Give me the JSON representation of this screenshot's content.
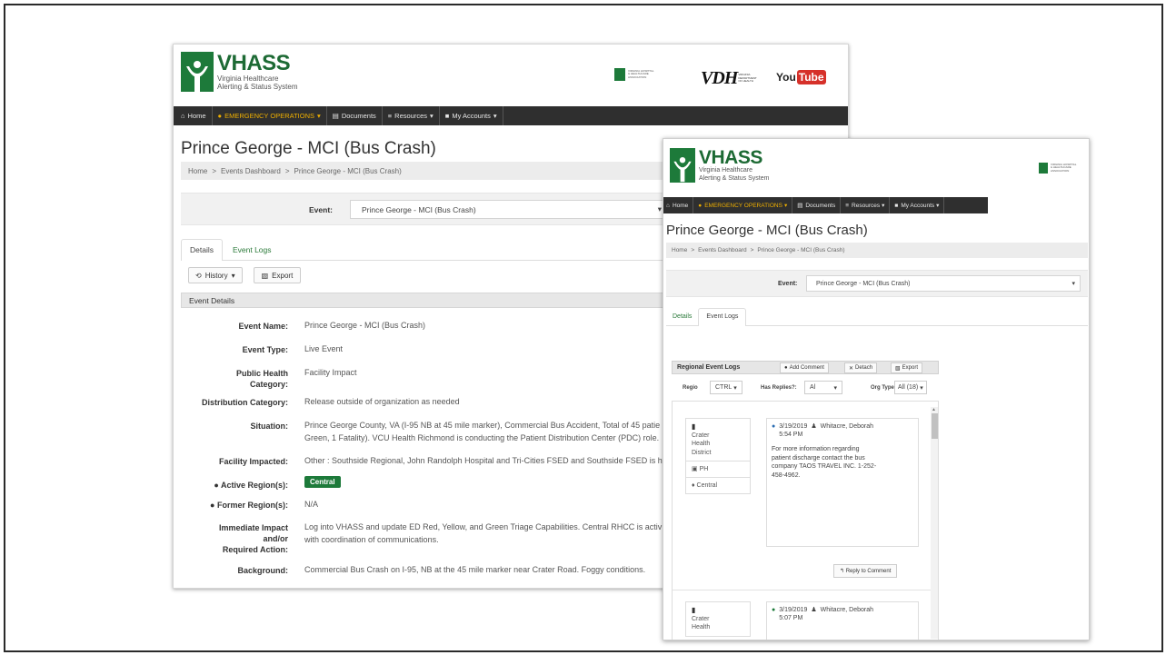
{
  "brand": {
    "name": "VHASS",
    "subtitle_line1": "Virginia Healthcare",
    "subtitle_line2": "Alerting & Status System",
    "color": "#1d7a3a"
  },
  "partners": {
    "vhha_line1": "VIRGINIA HOSPITAL",
    "vhha_line2": "& HEALTHCARE",
    "vhha_line3": "ASSOCIATION",
    "vdh_mark": "VDH",
    "vdh_line1": "VIRGINIA",
    "vdh_line2": "DEPARTMENT",
    "vdh_line3": "OF HEALTH",
    "youtube_left": "You",
    "youtube_right": "Tube"
  },
  "nav": {
    "home": "Home",
    "emergency": "EMERGENCY OPERATIONS",
    "documents": "Documents",
    "resources": "Resources",
    "accounts": "My Accounts",
    "emergency_color": "#f0b000"
  },
  "page": {
    "title": "Prince George - MCI (Bus Crash)",
    "crumb_home": "Home",
    "crumb_dashboard": "Events Dashboard",
    "crumb_current": "Prince George - MCI (Bus Crash)",
    "sep": ">",
    "event_label": "Event:",
    "event_value": "Prince George - MCI (Bus Crash)"
  },
  "tabs": {
    "details": "Details",
    "event_logs": "Event Logs"
  },
  "toolbar": {
    "history": "History",
    "export": "Export"
  },
  "details": {
    "panel_title": "Event Details",
    "event_name_label": "Event Name:",
    "event_name": "Prince George - MCI (Bus Crash)",
    "event_type_label": "Event Type:",
    "event_type": "Live Event",
    "ph_label_1": "Public Health",
    "ph_label_2": "Category:",
    "ph_value": "Facility Impact",
    "dist_label": "Distribution Category:",
    "dist_value": "Release outside of organization as needed",
    "situation_label": "Situation:",
    "situation_line1": "Prince George County, VA (I-95 NB at 45 mile marker), Commercial Bus Accident, Total of 45 patie",
    "situation_line2": "Green, 1 Fatality). VCU Health Richmond is conducting the Patient Distribution Center (PDC) role.",
    "facility_label": "Facility Impacted:",
    "facility_value": "Other : Southside Regional, John Randolph Hospital and Tri-Cities FSED and Southside FSED is h",
    "active_label": "Active Region(s):",
    "active_value": "Central",
    "former_label": "Former Region(s):",
    "former_value": "N/A",
    "impact_label_1": "Immediate Impact",
    "impact_label_2": "and/or",
    "impact_label_3": "Required Action:",
    "impact_line1": "Log into VHASS and update ED Red, Yellow, and Green Triage Capabilities. Central RHCC is activ",
    "impact_line2": "with coordination of communications.",
    "background_label": "Background:",
    "background_value": "Commercial Bus Crash on I-95, NB at the 45 mile marker near Crater Road. Foggy conditions."
  },
  "logs": {
    "panel_title": "Regional Event Logs",
    "add_comment": "Add Comment",
    "detach": "Detach",
    "export": "Export",
    "region_label": "Regio",
    "region_value": "CTRL",
    "replies_label": "Has Replies?:",
    "replies_value": "Al",
    "orgtype_label": "Org Type",
    "orgtype_value": "All (18)",
    "entries": [
      {
        "org_line1": "Crater",
        "org_line2": "Health",
        "org_line3": "District",
        "type": "PH",
        "region": "Central",
        "date": "3/19/2019",
        "time": "5:54 PM",
        "author": "Whitacre, Deborah",
        "text_line1": "For more information regarding",
        "text_line2": "patient discharge contact the bus",
        "text_line3": "company TAOS TRAVEL INC. 1-252-",
        "text_line4": "458-4962.",
        "reply": "Reply to Comment"
      },
      {
        "org_line1": "Crater",
        "org_line2": "Health",
        "date": "3/19/2019",
        "time": "5:07 PM",
        "author": "Whitacre, Deborah"
      }
    ]
  }
}
